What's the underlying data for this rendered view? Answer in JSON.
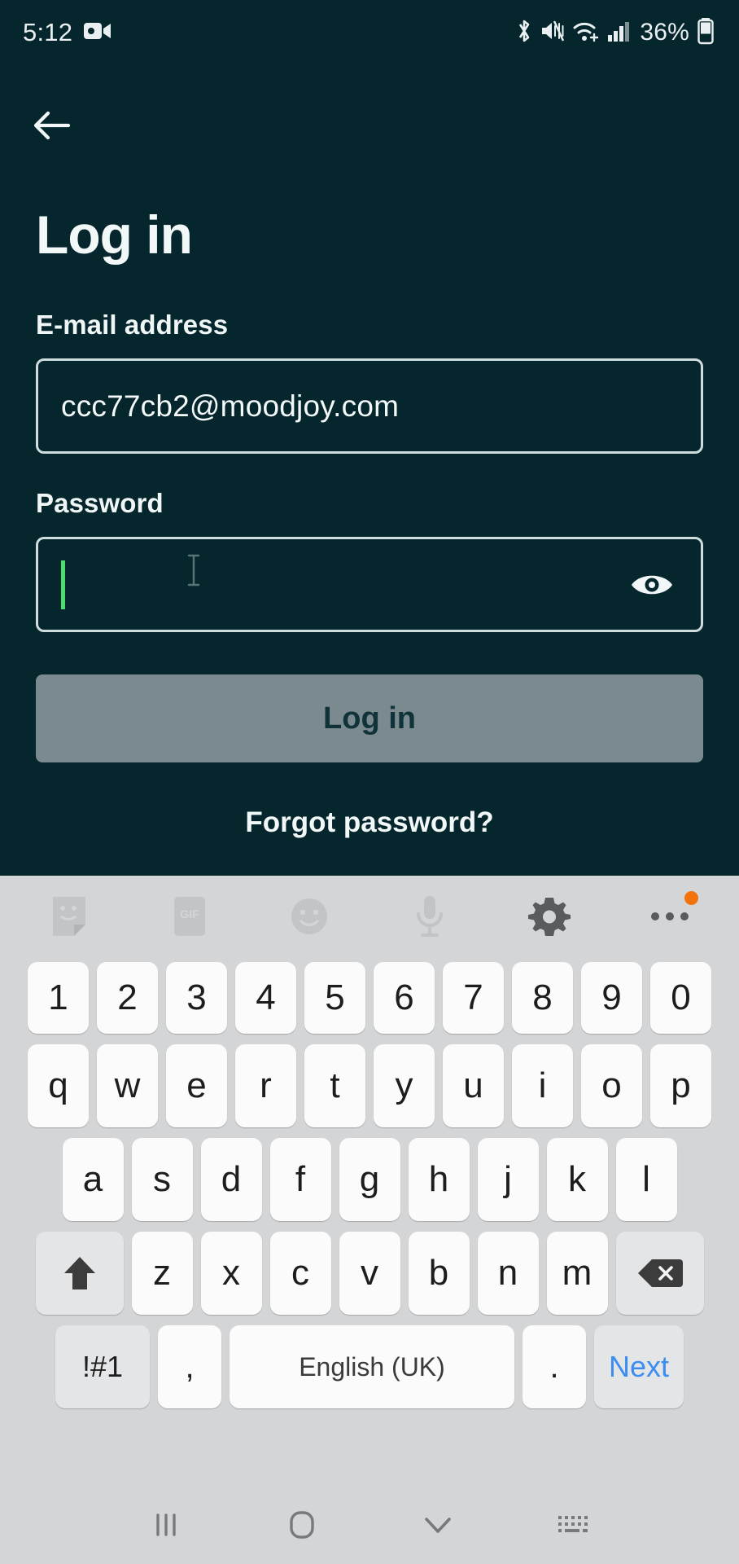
{
  "status_bar": {
    "time": "5:12",
    "battery_percent": "36%",
    "icons": [
      "video-camera-icon",
      "bluetooth-icon",
      "volume-muted-icon",
      "wifi-icon",
      "cellular-signal-icon",
      "battery-icon"
    ]
  },
  "screen": {
    "background_color": "#04262c",
    "back_label": "back",
    "title": "Log in"
  },
  "form": {
    "email": {
      "label": "E-mail address",
      "value": "ccc77cb2@moodjoy.com",
      "placeholder": "E-mail address"
    },
    "password": {
      "label": "Password",
      "value": "",
      "placeholder": "Password",
      "toggle_icon": "eye-icon",
      "caret_color": "#4ade6d"
    },
    "submit_label": "Log in",
    "submit_color": "#7a8a8e",
    "forgot_label": "Forgot password?"
  },
  "keyboard": {
    "toolbar": [
      {
        "name": "sticker-icon",
        "label": ""
      },
      {
        "name": "gif-icon",
        "label": "GIF"
      },
      {
        "name": "emoji-icon",
        "label": ""
      },
      {
        "name": "microphone-icon",
        "label": ""
      },
      {
        "name": "gear-icon",
        "label": ""
      },
      {
        "name": "more-options-icon",
        "label": "•••"
      }
    ],
    "badge_color": "#f2730c",
    "rows": {
      "numbers": [
        "1",
        "2",
        "3",
        "4",
        "5",
        "6",
        "7",
        "8",
        "9",
        "0"
      ],
      "top": [
        "q",
        "w",
        "e",
        "r",
        "t",
        "y",
        "u",
        "i",
        "o",
        "p"
      ],
      "home": [
        "a",
        "s",
        "d",
        "f",
        "g",
        "h",
        "j",
        "k",
        "l"
      ],
      "bottom": [
        "z",
        "x",
        "c",
        "v",
        "b",
        "n",
        "m"
      ]
    },
    "shift_label": "shift",
    "backspace_label": "backspace",
    "symbols_label": "!#1",
    "comma_label": ",",
    "space_label": "English (UK)",
    "period_label": ".",
    "next_label": "Next",
    "next_color": "#3b8ef0",
    "background_color": "#d4d5d7"
  },
  "nav_bar": {
    "recents_label": "recent-apps",
    "home_label": "home",
    "dismiss_label": "hide-keyboard",
    "switcher_label": "keyboard-switcher"
  }
}
